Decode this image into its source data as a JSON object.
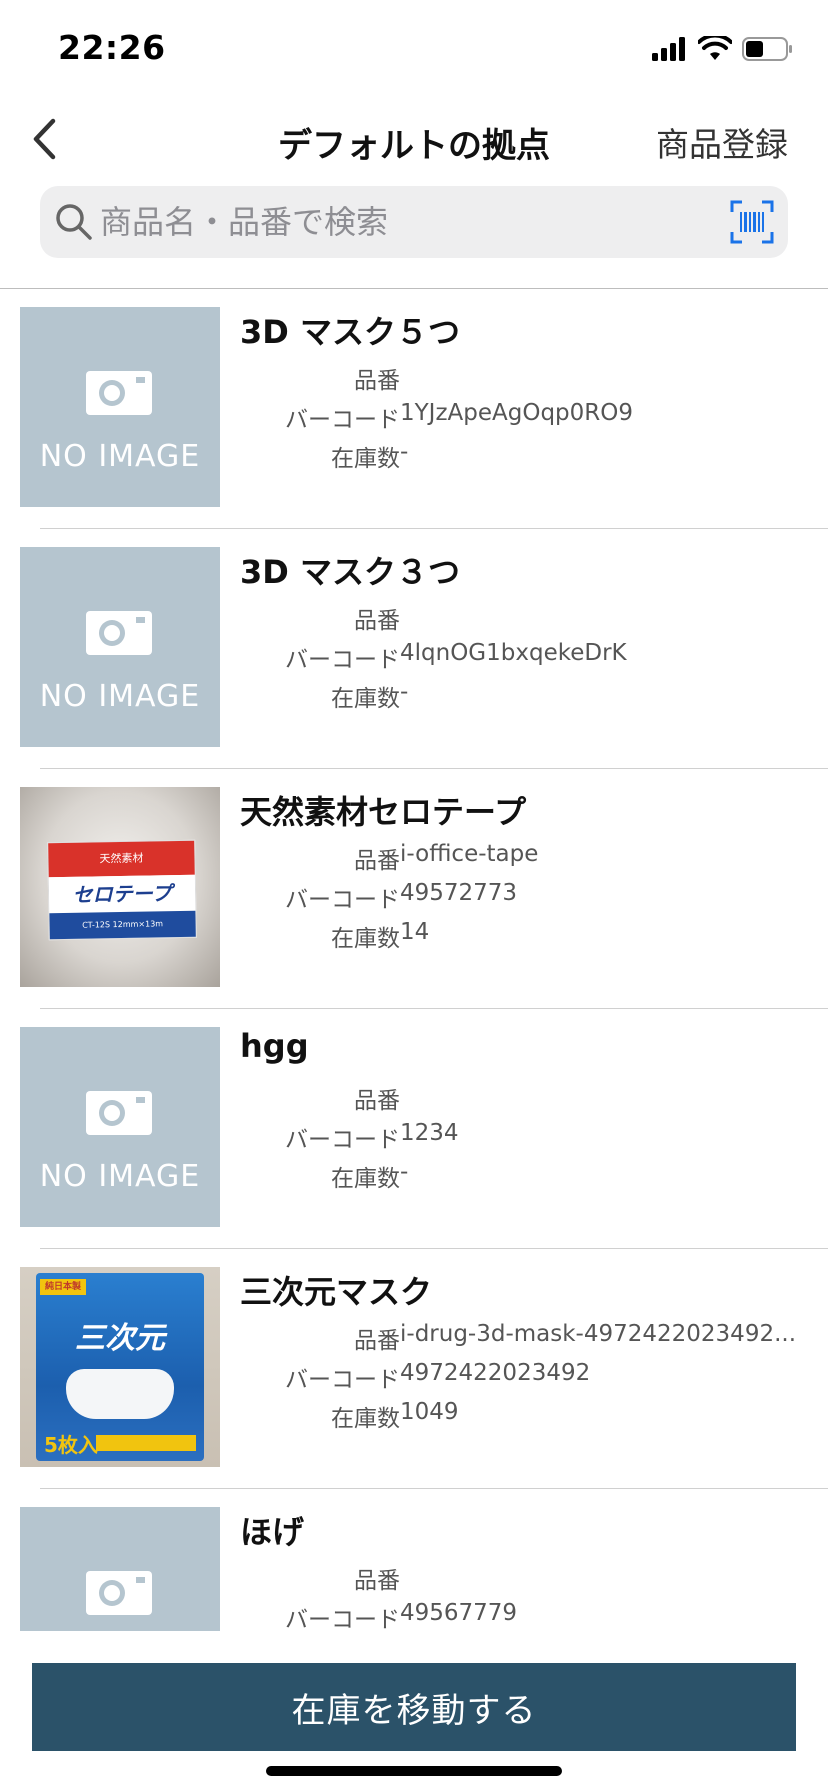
{
  "status_bar": {
    "time": "22:26"
  },
  "nav": {
    "back_icon": "chevron-left-icon",
    "title": "デフォルトの拠点",
    "action_label": "商品登録"
  },
  "search": {
    "placeholder": "商品名・品番で検索",
    "value": "",
    "icon": "search-icon",
    "scan_icon": "barcode-scan-icon"
  },
  "labels": {
    "part_number": "品番",
    "barcode": "バーコード",
    "stock": "在庫数",
    "no_image": "NO IMAGE"
  },
  "products": [
    {
      "name": "3D マスク５つ",
      "part_number": "",
      "barcode": "1YJzApeAgOqp0RO9",
      "stock": "-",
      "image": "none"
    },
    {
      "name": "3D マスク３つ",
      "part_number": "",
      "barcode": "4lqnOG1bxqekeDrK",
      "stock": "-",
      "image": "none"
    },
    {
      "name": "天然素材セロテープ",
      "part_number": "i-office-tape",
      "barcode": "49572773",
      "stock": "14",
      "image": "photo-tape"
    },
    {
      "name": "hgg",
      "part_number": "",
      "barcode": "1234",
      "stock": "-",
      "image": "none"
    },
    {
      "name": "三次元マスク",
      "part_number": "i-drug-3d-mask-4972422023492...",
      "barcode": "4972422023492",
      "stock": "1049",
      "image": "photo-mask"
    },
    {
      "name": "ほげ",
      "part_number": "",
      "barcode": "49567779",
      "stock": "",
      "image": "none"
    }
  ],
  "tape_photo": {
    "top_text": "天然素材",
    "brand": "セロテープ",
    "bottom_text": "CT-12S 12mm×13m"
  },
  "mask_photo": {
    "badge": "純日本製",
    "title": "三次元",
    "count": "5枚入"
  },
  "bottom": {
    "move_button_label": "在庫を移動する"
  },
  "colors": {
    "accent": "#2b5269",
    "scan_icon": "#1a73e8",
    "no_image_bg": "#b5c5cf"
  }
}
